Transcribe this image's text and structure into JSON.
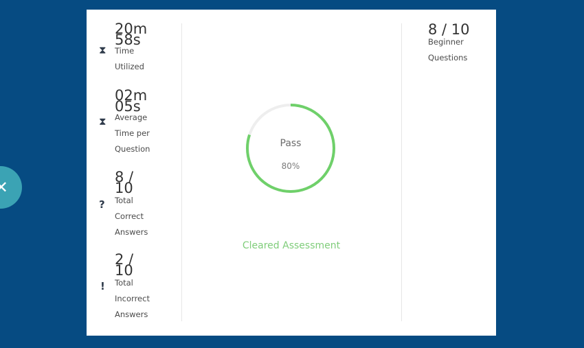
{
  "top_fragment": "",
  "stats": [
    {
      "icon": "hourglass-icon",
      "value": "20m 58s",
      "label": [
        "Time",
        "Utilized"
      ]
    },
    {
      "icon": "hourglass-icon",
      "value": "02m 05s",
      "label": [
        "Average",
        "Time per",
        "Question"
      ]
    },
    {
      "icon": "question-icon",
      "value": "8 / 10",
      "label": [
        "Total",
        "Correct",
        "Answers"
      ]
    },
    {
      "icon": "exclamation-icon",
      "value": "2 / 10",
      "label": [
        "Total",
        "Incorrect",
        "Answers"
      ]
    }
  ],
  "result": {
    "status": "Pass",
    "percent_text": "80%",
    "percent_value": 80,
    "message": "Cleared Assessment"
  },
  "level": {
    "value": "8 / 10",
    "label_1": "Beginner",
    "label_2": "Questions"
  },
  "close_button": {
    "icon": "close-icon",
    "glyph": "✕"
  },
  "colors": {
    "background": "#064b82",
    "card": "#ffffff",
    "ring_progress": "#6fd06a",
    "ring_track": "#eeeeee",
    "message": "#7fcd7a",
    "close_button": "#3ba3b4"
  }
}
